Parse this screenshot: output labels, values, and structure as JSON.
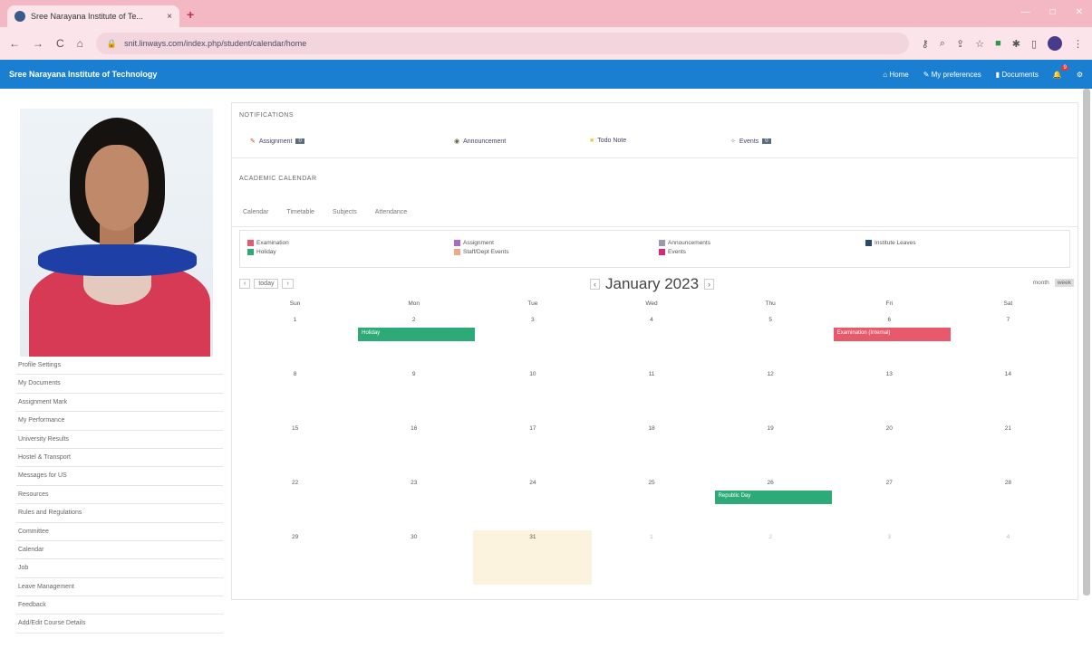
{
  "browser": {
    "tab_title": "Sree Narayana Institute of Te...",
    "tab_close": "×",
    "new_tab": "+",
    "window_controls": [
      "—",
      "□",
      "✕"
    ],
    "nav": [
      "←",
      "→",
      "C",
      "⌂"
    ],
    "url": "snit.linways.com/index.php/student/calendar/home"
  },
  "app": {
    "brand": "Sree Narayana Institute of Technology",
    "header_links": [
      "Home",
      "My preferences",
      "Documents"
    ],
    "notif_count": "9"
  },
  "sidebar": {
    "menu": [
      "Profile Settings",
      "My Documents",
      "Assignment Mark",
      "My Performance",
      "University Results",
      "Hostel & Transport",
      "Messages for US",
      "Resources",
      "Rules and Regulations",
      "Committee",
      "Calendar",
      "Job",
      "Leave Management",
      "Feedback",
      "Add/Edit Course Details"
    ]
  },
  "notifications": {
    "heading": "NOTIFICATIONS",
    "items": [
      {
        "label": "Assignment",
        "count": "0"
      },
      {
        "label": "Announcement",
        "count": ""
      },
      {
        "label": "Todo Note",
        "count": ""
      },
      {
        "label": "Events",
        "count": "0"
      }
    ]
  },
  "calendar": {
    "heading": "ACADEMIC CALENDAR",
    "tabs": [
      "Calendar",
      "Timetable",
      "Subjects",
      "Attendance"
    ],
    "legend": [
      "Examination",
      "Holiday",
      "Assignment",
      "Staff/Dept Events",
      "Announcements",
      "Events",
      "Institute Leaves"
    ],
    "nav_buttons": [
      "‹",
      "today",
      "›"
    ],
    "prev": "‹",
    "next": "›",
    "title": "January 2023",
    "views": [
      "month",
      "week"
    ],
    "days": [
      "Sun",
      "Mon",
      "Tue",
      "Wed",
      "Thu",
      "Fri",
      "Sat"
    ],
    "weeks": [
      [
        "1",
        "2",
        "3",
        "4",
        "5",
        "6",
        "7"
      ],
      [
        "8",
        "9",
        "10",
        "11",
        "12",
        "13",
        "14"
      ],
      [
        "15",
        "16",
        "17",
        "18",
        "19",
        "20",
        "21"
      ],
      [
        "22",
        "23",
        "24",
        "25",
        "26",
        "27",
        "28"
      ],
      [
        "29",
        "30",
        "31",
        "1",
        "2",
        "3",
        "4"
      ]
    ],
    "events": [
      "Holiday",
      "Examination (Internal)",
      "Republic Day"
    ]
  },
  "colors": {
    "app_bar": "#1a7fd0",
    "tab_bar": "#f4b8c4",
    "holiday": "#2eaa78",
    "exam": "#e8596b",
    "today": "#fcf3df"
  }
}
